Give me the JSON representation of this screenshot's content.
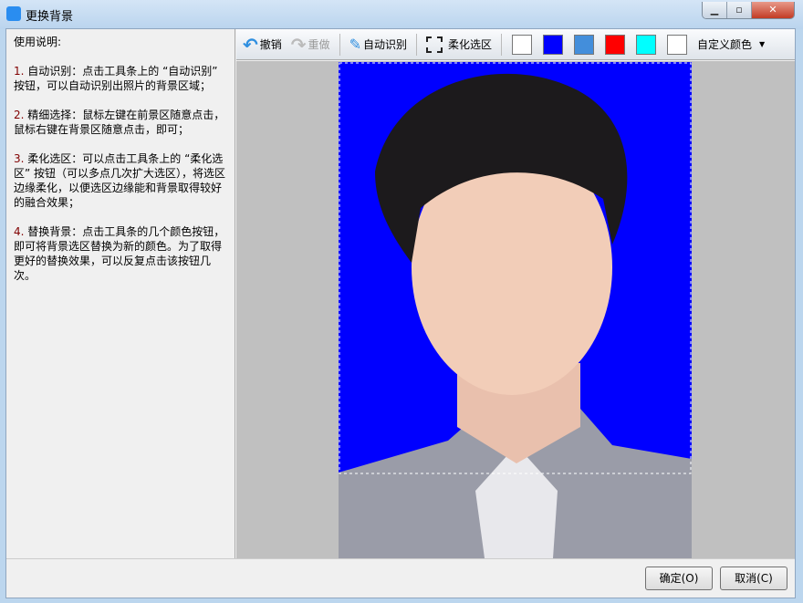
{
  "window": {
    "title": "更换背景"
  },
  "help": {
    "heading": "使用说明:",
    "items": [
      {
        "num": "1.",
        "text": " 自动识别：点击工具条上的 “自动识别” 按钮，可以自动识别出照片的背景区域；"
      },
      {
        "num": "2.",
        "text": " 精细选择：鼠标左键在前景区随意点击，鼠标右键在背景区随意点击，即可；"
      },
      {
        "num": "3.",
        "text": " 柔化选区：可以点击工具条上的 “柔化选区” 按钮（可以多点几次扩大选区），将选区边缘柔化，以便选区边缘能和背景取得较好的融合效果；"
      },
      {
        "num": "4.",
        "text": " 替换背景：点击工具条的几个颜色按钮，即可将背景选区替换为新的颜色。为了取得更好的替换效果，可以反复点击该按钮几次。"
      }
    ]
  },
  "toolbar": {
    "undo": "撤销",
    "redo": "重做",
    "auto": "自动识别",
    "feather": "柔化选区",
    "custom_color": "自定义颜色",
    "swatches": [
      "#ffffff",
      "#0000ff",
      "#438edb",
      "#ff0000",
      "#00ffff",
      "#ffffff"
    ]
  },
  "photo": {
    "background": "#0000ff"
  },
  "footer": {
    "ok": "确定(O)",
    "cancel": "取消(C)"
  }
}
